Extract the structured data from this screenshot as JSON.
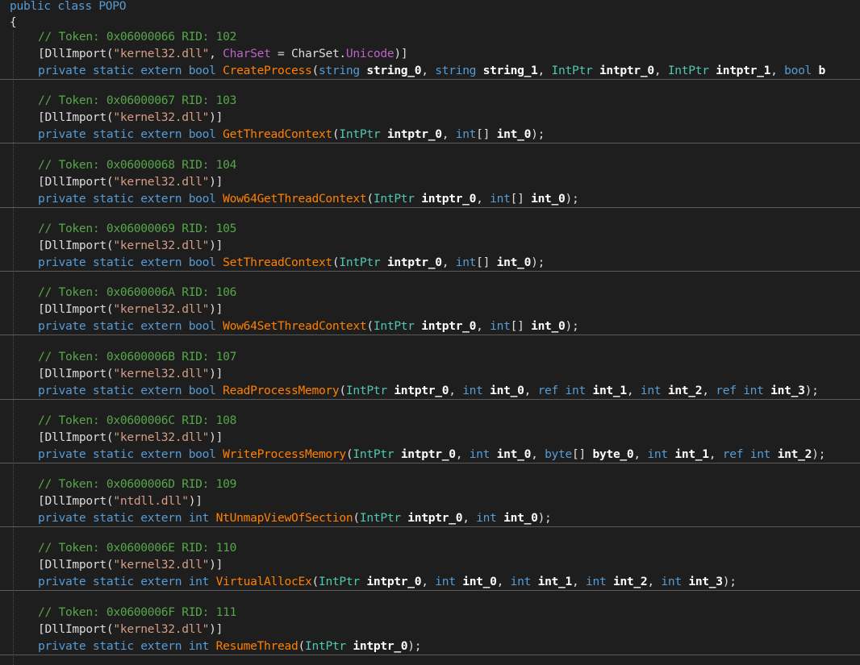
{
  "header": {
    "decl": [
      {
        "t": "public class POPO",
        "c": "kw"
      }
    ],
    "open_brace": "{"
  },
  "blocks": [
    {
      "comment": "// Token: 0x06000066 RID: 102",
      "attr": [
        {
          "t": "[DllImport(",
          "c": "pl"
        },
        {
          "t": "\"kernel32.dll\"",
          "c": "st"
        },
        {
          "t": ", ",
          "c": "pl"
        },
        {
          "t": "CharSet",
          "c": "pp"
        },
        {
          "t": " = CharSet.",
          "c": "pl"
        },
        {
          "t": "Unicode",
          "c": "pp"
        },
        {
          "t": ")]",
          "c": "pl"
        }
      ],
      "sig": [
        {
          "t": "private static extern bool ",
          "c": "kw"
        },
        {
          "t": "CreateProcess",
          "c": "fn"
        },
        {
          "t": "(",
          "c": "pl"
        },
        {
          "t": "string ",
          "c": "kw"
        },
        {
          "t": "string_0",
          "c": "par"
        },
        {
          "t": ", ",
          "c": "pl"
        },
        {
          "t": "string ",
          "c": "kw"
        },
        {
          "t": "string_1",
          "c": "par"
        },
        {
          "t": ", ",
          "c": "pl"
        },
        {
          "t": "IntPtr ",
          "c": "ty"
        },
        {
          "t": "intptr_0",
          "c": "par"
        },
        {
          "t": ", ",
          "c": "pl"
        },
        {
          "t": "IntPtr ",
          "c": "ty"
        },
        {
          "t": "intptr_1",
          "c": "par"
        },
        {
          "t": ", ",
          "c": "pl"
        },
        {
          "t": "bool ",
          "c": "kw"
        },
        {
          "t": "b",
          "c": "par"
        }
      ]
    },
    {
      "comment": "// Token: 0x06000067 RID: 103",
      "attr": [
        {
          "t": "[DllImport(",
          "c": "pl"
        },
        {
          "t": "\"kernel32.dll\"",
          "c": "st"
        },
        {
          "t": ")]",
          "c": "pl"
        }
      ],
      "sig": [
        {
          "t": "private static extern bool ",
          "c": "kw"
        },
        {
          "t": "GetThreadContext",
          "c": "fn"
        },
        {
          "t": "(",
          "c": "pl"
        },
        {
          "t": "IntPtr ",
          "c": "ty"
        },
        {
          "t": "intptr_0",
          "c": "par"
        },
        {
          "t": ", ",
          "c": "pl"
        },
        {
          "t": "int",
          "c": "kw"
        },
        {
          "t": "[] ",
          "c": "pl"
        },
        {
          "t": "int_0",
          "c": "par"
        },
        {
          "t": ");",
          "c": "pl"
        }
      ]
    },
    {
      "comment": "// Token: 0x06000068 RID: 104",
      "attr": [
        {
          "t": "[DllImport(",
          "c": "pl"
        },
        {
          "t": "\"kernel32.dll\"",
          "c": "st"
        },
        {
          "t": ")]",
          "c": "pl"
        }
      ],
      "sig": [
        {
          "t": "private static extern bool ",
          "c": "kw"
        },
        {
          "t": "Wow64GetThreadContext",
          "c": "fn"
        },
        {
          "t": "(",
          "c": "pl"
        },
        {
          "t": "IntPtr ",
          "c": "ty"
        },
        {
          "t": "intptr_0",
          "c": "par"
        },
        {
          "t": ", ",
          "c": "pl"
        },
        {
          "t": "int",
          "c": "kw"
        },
        {
          "t": "[] ",
          "c": "pl"
        },
        {
          "t": "int_0",
          "c": "par"
        },
        {
          "t": ");",
          "c": "pl"
        }
      ]
    },
    {
      "comment": "// Token: 0x06000069 RID: 105",
      "attr": [
        {
          "t": "[DllImport(",
          "c": "pl"
        },
        {
          "t": "\"kernel32.dll\"",
          "c": "st"
        },
        {
          "t": ")]",
          "c": "pl"
        }
      ],
      "sig": [
        {
          "t": "private static extern bool ",
          "c": "kw"
        },
        {
          "t": "SetThreadContext",
          "c": "fn"
        },
        {
          "t": "(",
          "c": "pl"
        },
        {
          "t": "IntPtr ",
          "c": "ty"
        },
        {
          "t": "intptr_0",
          "c": "par"
        },
        {
          "t": ", ",
          "c": "pl"
        },
        {
          "t": "int",
          "c": "kw"
        },
        {
          "t": "[] ",
          "c": "pl"
        },
        {
          "t": "int_0",
          "c": "par"
        },
        {
          "t": ");",
          "c": "pl"
        }
      ]
    },
    {
      "comment": "// Token: 0x0600006A RID: 106",
      "attr": [
        {
          "t": "[DllImport(",
          "c": "pl"
        },
        {
          "t": "\"kernel32.dll\"",
          "c": "st"
        },
        {
          "t": ")]",
          "c": "pl"
        }
      ],
      "sig": [
        {
          "t": "private static extern bool ",
          "c": "kw"
        },
        {
          "t": "Wow64SetThreadContext",
          "c": "fn"
        },
        {
          "t": "(",
          "c": "pl"
        },
        {
          "t": "IntPtr ",
          "c": "ty"
        },
        {
          "t": "intptr_0",
          "c": "par"
        },
        {
          "t": ", ",
          "c": "pl"
        },
        {
          "t": "int",
          "c": "kw"
        },
        {
          "t": "[] ",
          "c": "pl"
        },
        {
          "t": "int_0",
          "c": "par"
        },
        {
          "t": ");",
          "c": "pl"
        }
      ]
    },
    {
      "comment": "// Token: 0x0600006B RID: 107",
      "attr": [
        {
          "t": "[DllImport(",
          "c": "pl"
        },
        {
          "t": "\"kernel32.dll\"",
          "c": "st"
        },
        {
          "t": ")]",
          "c": "pl"
        }
      ],
      "sig": [
        {
          "t": "private static extern bool ",
          "c": "kw"
        },
        {
          "t": "ReadProcessMemory",
          "c": "fn"
        },
        {
          "t": "(",
          "c": "pl"
        },
        {
          "t": "IntPtr ",
          "c": "ty"
        },
        {
          "t": "intptr_0",
          "c": "par"
        },
        {
          "t": ", ",
          "c": "pl"
        },
        {
          "t": "int ",
          "c": "kw"
        },
        {
          "t": "int_0",
          "c": "par"
        },
        {
          "t": ", ",
          "c": "pl"
        },
        {
          "t": "ref int ",
          "c": "kw"
        },
        {
          "t": "int_1",
          "c": "par"
        },
        {
          "t": ", ",
          "c": "pl"
        },
        {
          "t": "int ",
          "c": "kw"
        },
        {
          "t": "int_2",
          "c": "par"
        },
        {
          "t": ", ",
          "c": "pl"
        },
        {
          "t": "ref int ",
          "c": "kw"
        },
        {
          "t": "int_3",
          "c": "par"
        },
        {
          "t": ");",
          "c": "pl"
        }
      ]
    },
    {
      "comment": "// Token: 0x0600006C RID: 108",
      "attr": [
        {
          "t": "[DllImport(",
          "c": "pl"
        },
        {
          "t": "\"kernel32.dll\"",
          "c": "st"
        },
        {
          "t": ")]",
          "c": "pl"
        }
      ],
      "sig": [
        {
          "t": "private static extern bool ",
          "c": "kw"
        },
        {
          "t": "WriteProcessMemory",
          "c": "fn"
        },
        {
          "t": "(",
          "c": "pl"
        },
        {
          "t": "IntPtr ",
          "c": "ty"
        },
        {
          "t": "intptr_0",
          "c": "par"
        },
        {
          "t": ", ",
          "c": "pl"
        },
        {
          "t": "int ",
          "c": "kw"
        },
        {
          "t": "int_0",
          "c": "par"
        },
        {
          "t": ", ",
          "c": "pl"
        },
        {
          "t": "byte",
          "c": "kw"
        },
        {
          "t": "[] ",
          "c": "pl"
        },
        {
          "t": "byte_0",
          "c": "par"
        },
        {
          "t": ", ",
          "c": "pl"
        },
        {
          "t": "int ",
          "c": "kw"
        },
        {
          "t": "int_1",
          "c": "par"
        },
        {
          "t": ", ",
          "c": "pl"
        },
        {
          "t": "ref int ",
          "c": "kw"
        },
        {
          "t": "int_2",
          "c": "par"
        },
        {
          "t": ");",
          "c": "pl"
        }
      ]
    },
    {
      "comment": "// Token: 0x0600006D RID: 109",
      "attr": [
        {
          "t": "[DllImport(",
          "c": "pl"
        },
        {
          "t": "\"ntdll.dll\"",
          "c": "st"
        },
        {
          "t": ")]",
          "c": "pl"
        }
      ],
      "sig": [
        {
          "t": "private static extern int ",
          "c": "kw"
        },
        {
          "t": "NtUnmapViewOfSection",
          "c": "fn"
        },
        {
          "t": "(",
          "c": "pl"
        },
        {
          "t": "IntPtr ",
          "c": "ty"
        },
        {
          "t": "intptr_0",
          "c": "par"
        },
        {
          "t": ", ",
          "c": "pl"
        },
        {
          "t": "int ",
          "c": "kw"
        },
        {
          "t": "int_0",
          "c": "par"
        },
        {
          "t": ");",
          "c": "pl"
        }
      ]
    },
    {
      "comment": "// Token: 0x0600006E RID: 110",
      "attr": [
        {
          "t": "[DllImport(",
          "c": "pl"
        },
        {
          "t": "\"kernel32.dll\"",
          "c": "st"
        },
        {
          "t": ")]",
          "c": "pl"
        }
      ],
      "sig": [
        {
          "t": "private static extern int ",
          "c": "kw"
        },
        {
          "t": "VirtualAllocEx",
          "c": "fn"
        },
        {
          "t": "(",
          "c": "pl"
        },
        {
          "t": "IntPtr ",
          "c": "ty"
        },
        {
          "t": "intptr_0",
          "c": "par"
        },
        {
          "t": ", ",
          "c": "pl"
        },
        {
          "t": "int ",
          "c": "kw"
        },
        {
          "t": "int_0",
          "c": "par"
        },
        {
          "t": ", ",
          "c": "pl"
        },
        {
          "t": "int ",
          "c": "kw"
        },
        {
          "t": "int_1",
          "c": "par"
        },
        {
          "t": ", ",
          "c": "pl"
        },
        {
          "t": "int ",
          "c": "kw"
        },
        {
          "t": "int_2",
          "c": "par"
        },
        {
          "t": ", ",
          "c": "pl"
        },
        {
          "t": "int ",
          "c": "kw"
        },
        {
          "t": "int_3",
          "c": "par"
        },
        {
          "t": ");",
          "c": "pl"
        }
      ]
    },
    {
      "comment": "// Token: 0x0600006F RID: 111",
      "attr": [
        {
          "t": "[DllImport(",
          "c": "pl"
        },
        {
          "t": "\"kernel32.dll\"",
          "c": "st"
        },
        {
          "t": ")]",
          "c": "pl"
        }
      ],
      "sig": [
        {
          "t": "private static extern int ",
          "c": "kw"
        },
        {
          "t": "ResumeThread",
          "c": "fn"
        },
        {
          "t": "(",
          "c": "pl"
        },
        {
          "t": "IntPtr ",
          "c": "ty"
        },
        {
          "t": "intptr_0",
          "c": "par"
        },
        {
          "t": ");",
          "c": "pl"
        }
      ]
    }
  ],
  "colors": {
    "background": "#1e1e1e",
    "keyword": "#569cd6",
    "comment": "#57a64a",
    "type": "#4ec9b0",
    "string": "#d69d85",
    "method": "#ff8000",
    "property": "#bd63c5",
    "plain": "#dcdcdc",
    "parameter": "#ffffff"
  }
}
